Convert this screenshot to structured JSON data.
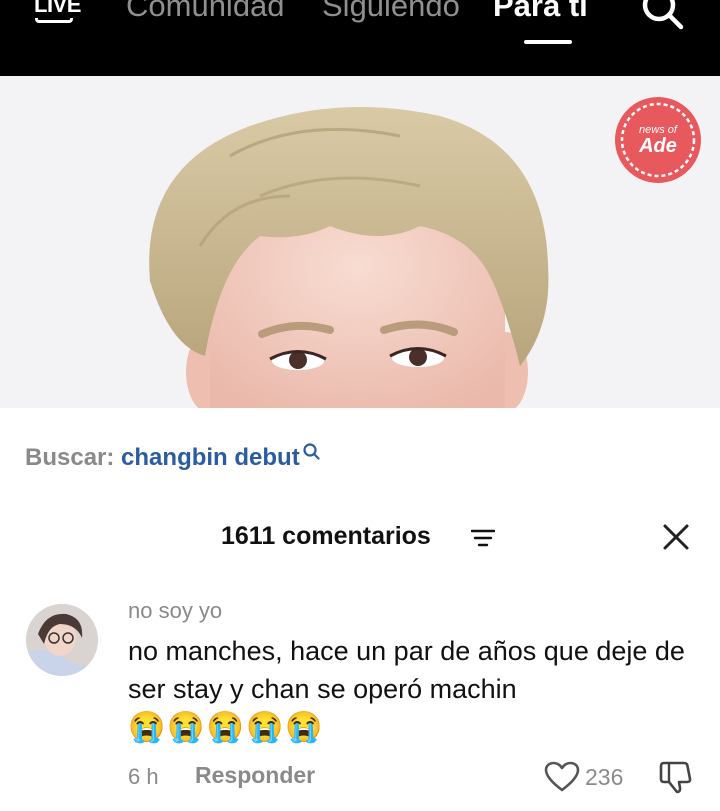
{
  "topbar": {
    "live_label": "LIVE",
    "tabs": [
      {
        "label": "Comunidad"
      },
      {
        "label": "Siguiendo"
      },
      {
        "label": "Para ti"
      }
    ]
  },
  "video": {
    "badge_top": "news of",
    "badge_main": "Ade"
  },
  "search_suggestion": {
    "label": "Buscar:",
    "query": "changbin debut"
  },
  "comments": {
    "title": "1611 comentarios"
  },
  "comment": {
    "username": "no soy yo",
    "text": "no manches, hace un par de años que deje de ser stay y chan se operó machin",
    "emoji": "😭😭😭😭😭",
    "time": "6 h",
    "reply_label": "Responder",
    "likes": "236"
  },
  "colors": {
    "topbar": "#000000",
    "link": "#2b5c9f",
    "muted": "#8a8a8a",
    "badge": "#e8595e"
  },
  "icons": [
    "search-icon",
    "filter-icon",
    "close-icon",
    "heart-icon",
    "dislike-icon"
  ]
}
